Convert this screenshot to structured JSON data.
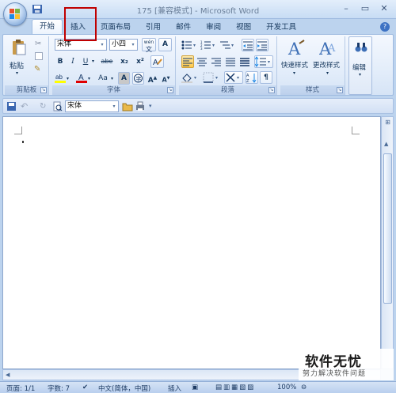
{
  "window": {
    "title": "175 [兼容模式] - Microsoft Word",
    "controls": [
      "–",
      "▭",
      "✕"
    ]
  },
  "tabs": [
    "开始",
    "插入",
    "页面布局",
    "引用",
    "邮件",
    "审阅",
    "视图",
    "开发工具"
  ],
  "active_tab": "开始",
  "highlighted_tab": "插入",
  "ribbon": {
    "clipboard": {
      "label": "剪贴板",
      "paste": "粘贴"
    },
    "font": {
      "label": "字体",
      "font_name": "宋体",
      "font_size": "小四",
      "wen": "wén",
      "buttons": [
        "B",
        "I",
        "U",
        "abe",
        "x₂",
        "x²",
        "A",
        "Aa",
        "A"
      ]
    },
    "paragraph": {
      "label": "段落"
    },
    "styles": {
      "label": "样式",
      "quick_styles": "快速样式",
      "change_styles": "更改样式"
    },
    "editing": {
      "label": "编辑",
      "button": "编辑"
    }
  },
  "toolbar": {
    "font_name": "宋体"
  },
  "status": {
    "page": "页面: 1/1",
    "words": "字数: 7",
    "language": "中文(简体，中国)",
    "mode": "插入",
    "zoom": "100%"
  },
  "watermark": {
    "main": "软件无忧",
    "sub": "努力解决软件问题"
  },
  "colors": {
    "accent": "#c00000",
    "ribbon_bg": "#e3edfa",
    "frame": "#bcd3ee"
  }
}
